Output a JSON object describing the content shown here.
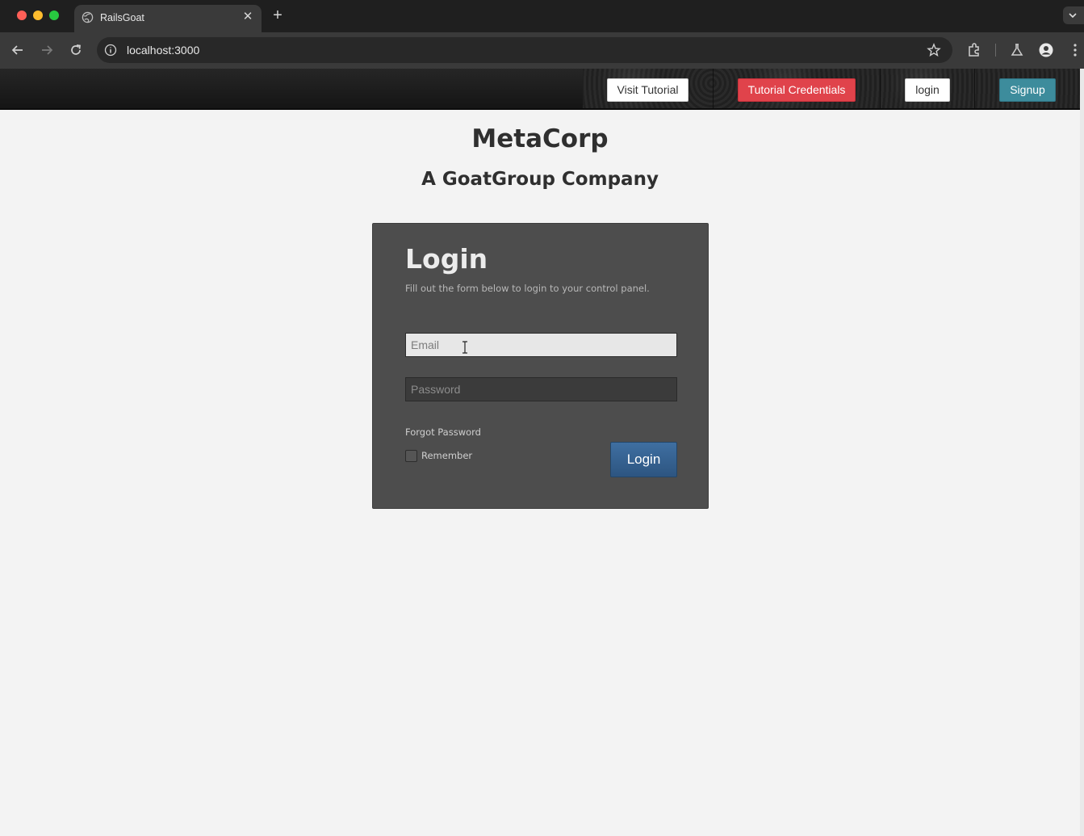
{
  "browser": {
    "tab_title": "RailsGoat",
    "url": "localhost:3000",
    "icons": [
      "back-arrow-icon",
      "forward-arrow-icon",
      "reload-icon",
      "site-info-icon",
      "bookmark-star-icon",
      "extensions-icon",
      "labs-flask-icon",
      "profile-icon",
      "kebab-menu-icon"
    ]
  },
  "header": {
    "visit_tutorial": "Visit Tutorial",
    "tutorial_credentials": "Tutorial Credentials",
    "login": "login",
    "signup": "Signup"
  },
  "brand": {
    "title": "MetaCorp",
    "subtitle": "A GoatGroup Company"
  },
  "login_form": {
    "title": "Login",
    "description": "Fill out the form below to login to your control panel.",
    "email_placeholder": "Email",
    "email_value": "",
    "password_placeholder": "Password",
    "password_value": "",
    "forgot_password": "Forgot Password",
    "remember_label": "Remember",
    "remember_checked": false,
    "submit_label": "Login"
  },
  "colors": {
    "credentials_button": "#e0434b",
    "signup_button": "#3d8c9c",
    "login_button": "#3f6fa1",
    "login_panel": "#4d4d4d"
  }
}
